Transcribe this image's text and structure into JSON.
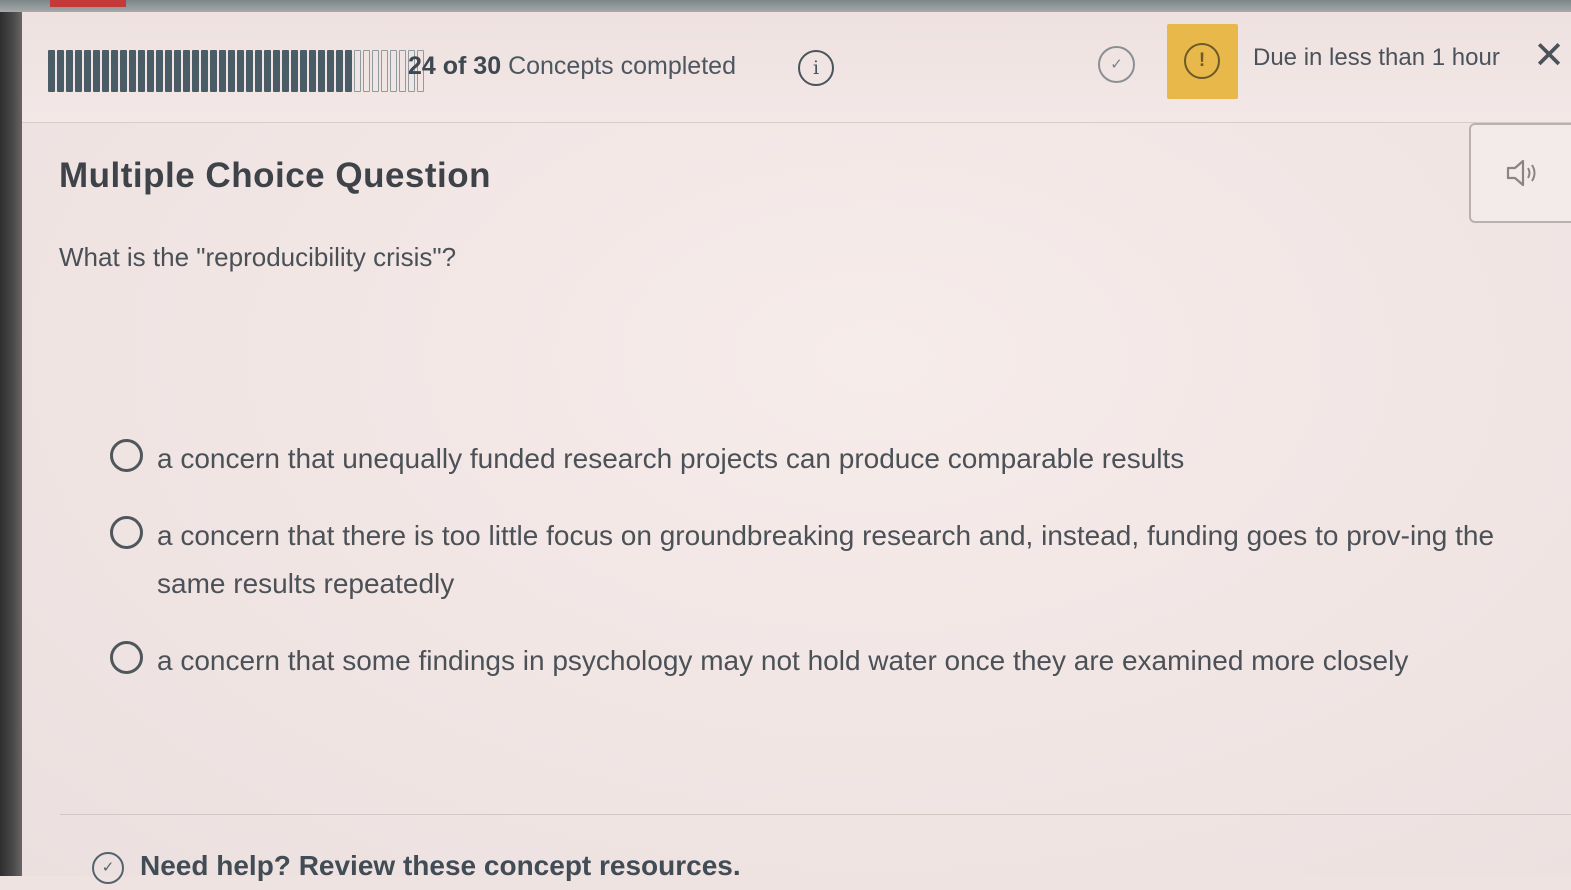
{
  "header": {
    "progress": {
      "completed": 24,
      "total": 30,
      "count_text": "24 of 30",
      "label": "Concepts completed"
    },
    "info_icon_glyph": "i",
    "check_icon_glyph": "✓",
    "alert_icon_glyph": "!",
    "due_text": "Due in less than 1 hour",
    "close_glyph": "✕"
  },
  "question": {
    "type_label": "Multiple Choice Question",
    "prompt": "What is the \"reproducibility crisis\"?",
    "options": [
      {
        "label": "a concern that unequally funded research projects can produce comparable results"
      },
      {
        "label": "a concern that there is too little focus on groundbreaking research and, instead, funding goes to prov-ing the same results repeatedly"
      },
      {
        "label": "a concern that some findings in psychology may not hold water once they are examined more closely"
      }
    ]
  },
  "help": {
    "text": "Need help? Review these concept resources.",
    "icon_glyph": "✓"
  },
  "icons": {
    "info": "info-icon",
    "check": "check-circle-icon",
    "alert": "alert-icon",
    "close": "close-icon",
    "audio": "speaker-icon",
    "help": "chevron-down-icon"
  },
  "colors": {
    "alert_background": "#e8b84a",
    "progress_done": "#4a5c66",
    "text": "#4b5157"
  }
}
